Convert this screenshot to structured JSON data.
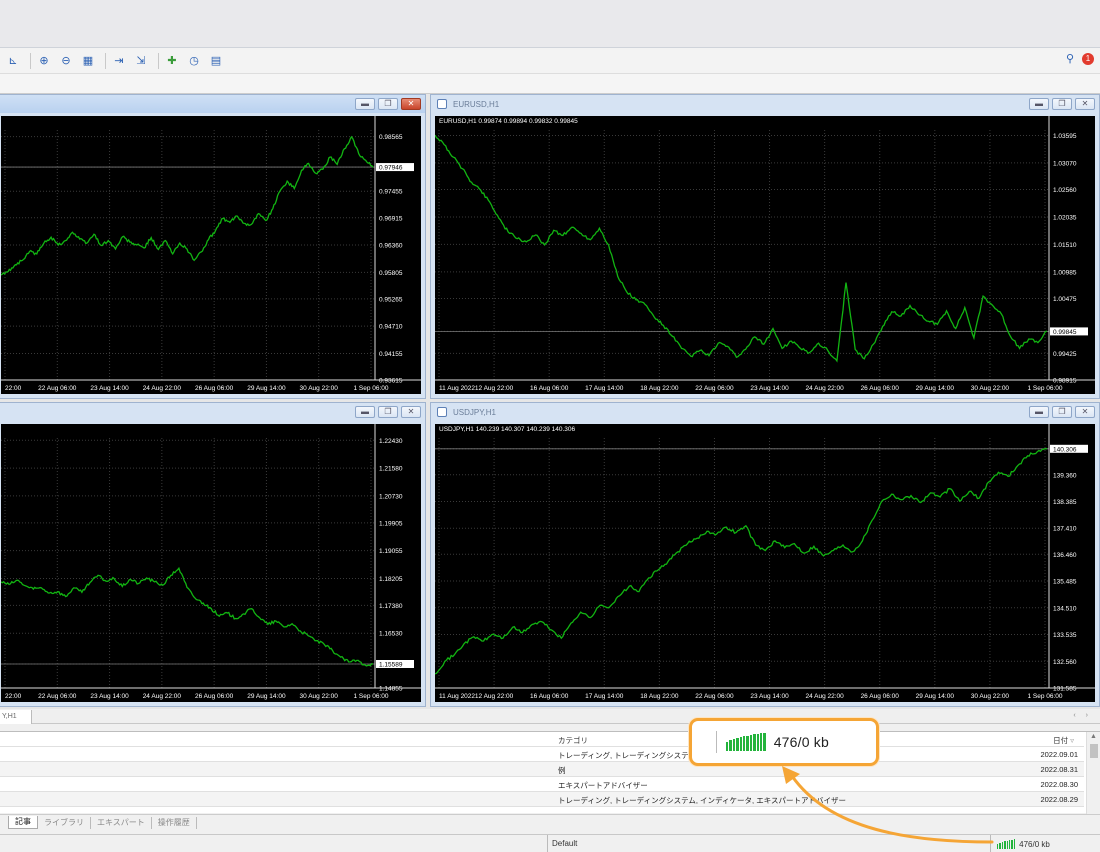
{
  "toolbar": {
    "icons": [
      "period-separator-icon",
      "chart-bars-icon",
      "zoom-in-icon",
      "zoom-out-icon",
      "tile-windows-icon",
      "chart-shift-icon",
      "autoscroll-icon",
      "indicator-add-icon",
      "clock-icon",
      "template-icon"
    ],
    "right_icons": [
      "search-icon",
      "notifications-icon"
    ],
    "notification_count": "1"
  },
  "charts": [
    {
      "id": "chart-top-left",
      "title": "",
      "symbol_line": "",
      "active": true,
      "price_levels": [
        "0.98565",
        "0.97946",
        "0.97455",
        "0.96915",
        "0.96360",
        "0.95805",
        "0.95265",
        "0.94710",
        "0.94155",
        "0.93615"
      ],
      "current_price": "0.97946",
      "time_labels": [
        "22:00",
        "22 Aug 06:00",
        "23 Aug 14:00",
        "24 Aug 22:00",
        "26 Aug 06:00",
        "29 Aug 14:00",
        "30 Aug 22:00",
        "1 Sep 06:00"
      ],
      "series": [
        0.9575,
        0.9582,
        0.9596,
        0.9605,
        0.9623,
        0.9618,
        0.964,
        0.9652,
        0.9636,
        0.9645,
        0.9662,
        0.9648,
        0.964,
        0.9658,
        0.9635,
        0.9645,
        0.9628,
        0.9653,
        0.9642,
        0.9636,
        0.963,
        0.9651,
        0.9627,
        0.9645,
        0.9618,
        0.964,
        0.9628,
        0.9605,
        0.9622,
        0.9647,
        0.9666,
        0.969,
        0.9682,
        0.9695,
        0.968,
        0.9678,
        0.97,
        0.9686,
        0.971,
        0.9746,
        0.9766,
        0.9751,
        0.9788,
        0.9802,
        0.9782,
        0.979,
        0.9815,
        0.98,
        0.9832,
        0.9856,
        0.9822,
        0.9808,
        0.9794
      ],
      "ylim": [
        0.93615,
        0.987
      ]
    },
    {
      "id": "chart-eurusd",
      "title": "EURUSD,H1",
      "symbol_line": "EURUSD,H1  0.99874 0.99894 0.99832 0.99845",
      "active": false,
      "price_levels": [
        "1.03595",
        "1.03070",
        "1.02560",
        "1.02035",
        "1.01510",
        "1.00985",
        "1.00475",
        "0.99845",
        "0.99425",
        "0.98915"
      ],
      "current_price": "0.99845",
      "time_labels": [
        "11 Aug 2022",
        "12 Aug 22:00",
        "16 Aug 06:00",
        "17 Aug 14:00",
        "18 Aug 22:00",
        "22 Aug 06:00",
        "23 Aug 14:00",
        "24 Aug 22:00",
        "26 Aug 06:00",
        "29 Aug 14:00",
        "30 Aug 22:00",
        "1 Sep 06:00"
      ],
      "series": [
        1.036,
        1.0342,
        1.0318,
        1.0296,
        1.027,
        1.0255,
        1.0232,
        1.0201,
        1.0175,
        1.0162,
        1.0156,
        1.0169,
        1.015,
        1.0178,
        1.0168,
        1.0184,
        1.0172,
        1.016,
        1.0182,
        1.015,
        1.009,
        1.006,
        1.0045,
        1.0036,
        1.0012,
        0.9996,
        0.9975,
        0.9952,
        0.9937,
        0.9948,
        0.9938,
        0.9962,
        0.9956,
        0.9935,
        0.995,
        0.9974,
        0.996,
        0.999,
        0.9952,
        0.9966,
        0.9952,
        0.9944,
        0.9962,
        0.9948,
        0.9928,
        1.0078,
        0.995,
        0.9932,
        0.996,
        0.9994,
        1.0022,
        1.0014,
        1.0034,
        1.0016,
        1.0004,
        0.9998,
        1.0024,
        0.999,
        1.003,
        0.9972,
        1.0052,
        1.0035,
        1.0018,
        0.9975,
        0.9952,
        0.997,
        0.9963,
        0.9985
      ],
      "ylim": [
        0.98915,
        1.037
      ]
    },
    {
      "id": "chart-bottom-left",
      "title": "",
      "symbol_line": "",
      "active": false,
      "price_levels": [
        "1.22430",
        "1.21580",
        "1.20730",
        "1.19905",
        "1.19055",
        "1.18205",
        "1.17380",
        "1.16530",
        "1.15589",
        "1.14855"
      ],
      "current_price": "1.15589",
      "time_labels": [
        "22:00",
        "22 Aug 06:00",
        "23 Aug 14:00",
        "24 Aug 22:00",
        "26 Aug 06:00",
        "29 Aug 14:00",
        "30 Aug 22:00",
        "1 Sep 06:00"
      ],
      "series": [
        1.181,
        1.1802,
        1.1815,
        1.1798,
        1.1788,
        1.1792,
        1.1776,
        1.178,
        1.1765,
        1.1792,
        1.1778,
        1.1808,
        1.183,
        1.1812,
        1.182,
        1.1796,
        1.1818,
        1.1805,
        1.1822,
        1.181,
        1.18,
        1.183,
        1.1852,
        1.1793,
        1.176,
        1.1745,
        1.1728,
        1.1705,
        1.1715,
        1.1698,
        1.1712,
        1.1728,
        1.17,
        1.168,
        1.169,
        1.1672,
        1.1682,
        1.166,
        1.1645,
        1.163,
        1.1618,
        1.16,
        1.158,
        1.1565,
        1.157,
        1.1556,
        1.1559
      ],
      "ylim": [
        1.14855,
        1.225
      ]
    },
    {
      "id": "chart-usdjpy",
      "title": "USDJPY,H1",
      "symbol_line": "USDJPY,H1  140.239 140.307 140.239 140.306",
      "active": false,
      "price_levels": [
        "140.306",
        "139.360",
        "138.385",
        "137.410",
        "136.460",
        "135.485",
        "134.510",
        "133.535",
        "132.560",
        "131.585"
      ],
      "current_price": "140.306",
      "time_labels": [
        "11 Aug 2022",
        "12 Aug 22:00",
        "16 Aug 06:00",
        "17 Aug 14:00",
        "18 Aug 22:00",
        "22 Aug 06:00",
        "23 Aug 14:00",
        "24 Aug 22:00",
        "26 Aug 06:00",
        "29 Aug 14:00",
        "30 Aug 22:00",
        "1 Sep 06:00"
      ],
      "series": [
        132.1,
        132.55,
        132.8,
        133.2,
        133.45,
        133.3,
        133.55,
        133.4,
        133.8,
        133.6,
        133.9,
        134.0,
        133.7,
        133.4,
        133.95,
        134.35,
        134.15,
        134.6,
        134.55,
        134.95,
        135.3,
        135.1,
        135.6,
        135.9,
        136.2,
        136.55,
        136.85,
        137.05,
        137.3,
        137.2,
        137.45,
        137.25,
        137.5,
        136.8,
        136.6,
        136.95,
        136.7,
        136.85,
        136.5,
        136.75,
        136.4,
        136.6,
        136.8,
        136.55,
        136.95,
        137.7,
        138.4,
        138.65,
        138.45,
        138.6,
        138.35,
        138.7,
        138.55,
        138.85,
        138.4,
        138.75,
        138.5,
        139.1,
        139.45,
        139.3,
        139.7,
        140.05,
        140.2,
        140.31
      ],
      "ylim": [
        131.585,
        140.7
      ]
    }
  ],
  "tabstrip": {
    "label": "Y,H1"
  },
  "news": {
    "header": {
      "category": "カテゴリ",
      "date": "日付"
    },
    "rows": [
      {
        "category": "トレーディング, トレーディングシステム",
        "date": "2022.09.01"
      },
      {
        "category": "例",
        "date": "2022.08.31"
      },
      {
        "category": "エキスパートアドバイザー",
        "date": "2022.08.30"
      },
      {
        "category": "トレーディング, トレーディングシステム, インディケータ, エキスパートアドバイザー",
        "date": "2022.08.29"
      }
    ]
  },
  "bottom_tabs": [
    "記事",
    "ライブラリ",
    "エキスパート",
    "操作履歴"
  ],
  "status": {
    "profile": "Default",
    "traffic": "476/0 kb"
  },
  "callout": {
    "traffic": "476/0 kb",
    "color": "#f5a535"
  }
}
